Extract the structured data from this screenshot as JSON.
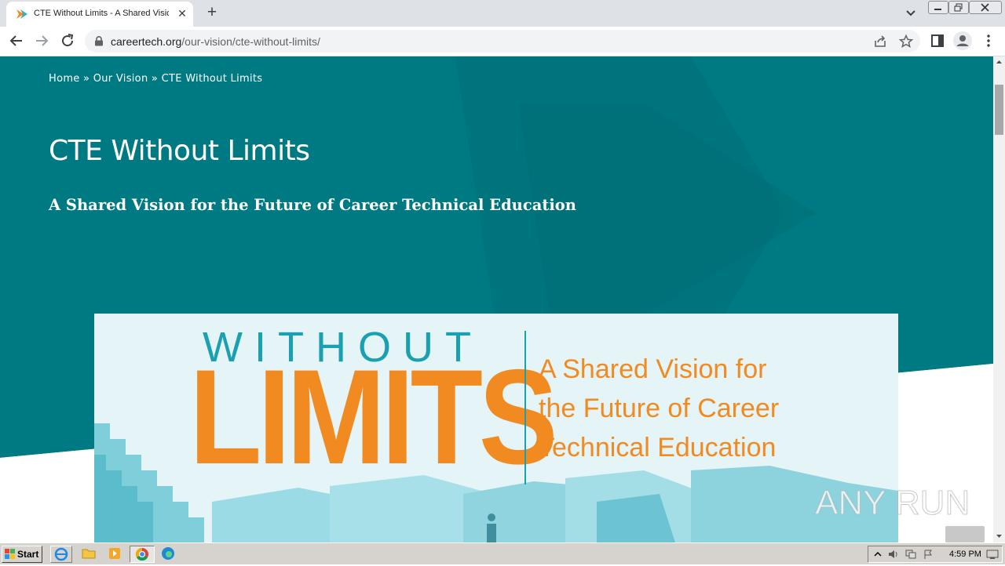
{
  "browser": {
    "tab": {
      "title": "CTE Without Limits - A Shared Vision",
      "close_label": "✕"
    },
    "new_tab_label": "+",
    "url": {
      "host": "careertech.org",
      "path": "/our-vision/cte-without-limits/"
    }
  },
  "page": {
    "breadcrumb": [
      {
        "label": "Home"
      },
      {
        "label": "Our Vision"
      },
      {
        "label": "CTE Without Limits"
      }
    ],
    "breadcrumb_separator": "»",
    "title": "CTE Without Limits",
    "subtitle": "A Shared Vision for the Future of Career Technical Education",
    "banner": {
      "word_top": "WITHOUT",
      "word_main": "LIMITS",
      "tagline_lines": [
        "A Shared Vision for",
        "the Future of Career",
        "Technical Education"
      ]
    }
  },
  "watermark": {
    "text": "ANY RUN"
  },
  "taskbar": {
    "start_label": "Start",
    "clock": "4:59 PM"
  },
  "colors": {
    "hero_teal": "#007a82",
    "banner_orange": "#f28a22",
    "banner_teal": "#1aa0b0"
  },
  "icons": {
    "tab": "careertech-favicon",
    "omnibox": [
      "lock-icon",
      "share-icon",
      "star-icon"
    ],
    "toolbar": [
      "back-arrow-icon",
      "forward-arrow-icon",
      "reload-icon",
      "side-panel-icon",
      "profile-icon",
      "kebab-menu-icon"
    ]
  }
}
